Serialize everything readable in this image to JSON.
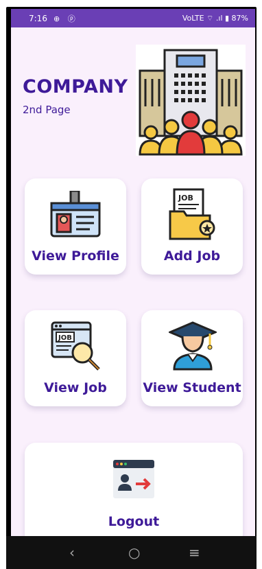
{
  "status": {
    "time": "7:16",
    "left_icons": "⊕ ⓟ",
    "right_text": "VoLTE ⌔ .ıl ▮ 87%",
    "battery": "87%"
  },
  "header": {
    "title": "COMPANY",
    "subtitle": "2nd Page"
  },
  "cards": {
    "view_profile": "View Profile",
    "add_job": "Add Job",
    "view_job": "View Job",
    "view_student": "View Student",
    "logout": "Logout"
  },
  "icons": {
    "add_job_doc": "JOB",
    "view_job_doc": "JOB"
  },
  "nav": {
    "back": "‹",
    "home": "○",
    "recents": "≡"
  },
  "colors": {
    "accent": "#3e1a98",
    "statusbar": "#6a3fb5",
    "background": "#faf0fc"
  }
}
